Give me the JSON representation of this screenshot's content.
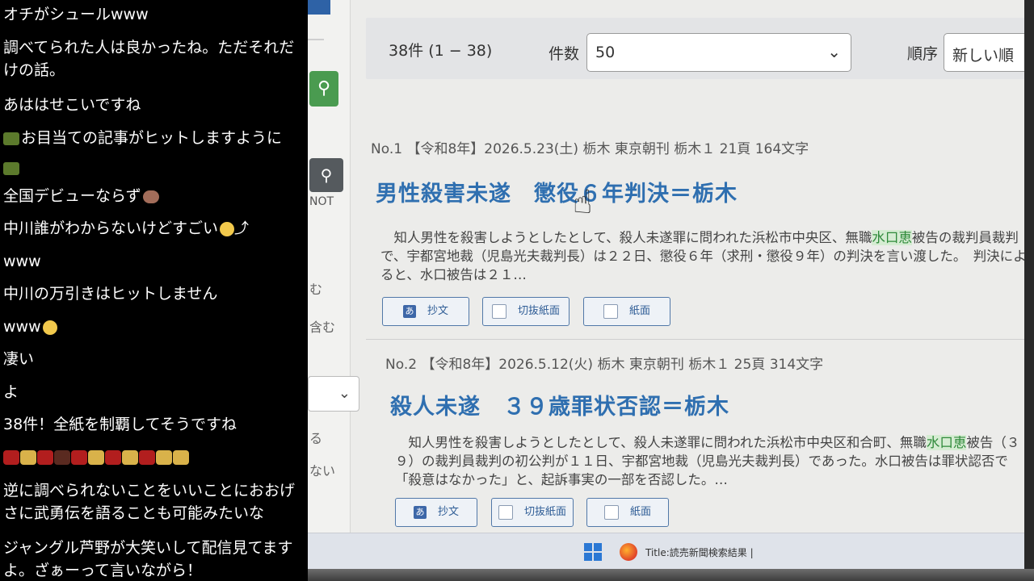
{
  "chat": {
    "messages": [
      "オチがシュールwww",
      "調べてられた人は良かったね。ただそれだけの話。",
      "あははせこいですね",
      "お目当ての記事がヒットしますように",
      "",
      "全国デビューならず",
      "中川誰がわからないけどすごい",
      "www",
      "中川の万引きはヒットしません",
      "www",
      "凄い",
      "よ",
      "38件！全紙を制覇してそうですね",
      "",
      "逆に調べられないことをいいことにおおげさに武勇伝を語ることも可能みたいな",
      "ジャングル芦野が大笑いして配信見てますよ。ざぁーって言いながら！"
    ]
  },
  "sidebar": {
    "not_label": "NOT",
    "frag1": "む",
    "frag2": "含む",
    "frag3": "る",
    "frag4": "ない"
  },
  "results": {
    "count_text": "38件 (1 − 38)",
    "per_page_label": "件数",
    "per_page_value": "50",
    "order_label": "順序",
    "order_value": "新しい順"
  },
  "articles": [
    {
      "meta": "No.1 【令和8年】2026.5.23(土) 栃木 東京朝刊 栃木１ 21頁 164文字",
      "headline": "男性殺害未遂　懲役６年判決＝栃木",
      "body_pre": "　知人男性を殺害しようとしたとして、殺人未遂罪に問われた浜松市中央区、無職",
      "body_hl": "水口恵",
      "body_post": "被告の裁判員裁判で、宇都宮地裁（児島光夫裁判長）は２２日、懲役６年（求刑・懲役９年）の判決を言い渡した。　判決によると、水口被告は２１…",
      "buttons": [
        "抄文",
        "切抜紙面",
        "紙面"
      ]
    },
    {
      "meta": "No.2 【令和8年】2026.5.12(火) 栃木 東京朝刊 栃木１ 25頁 314文字",
      "headline": "殺人未遂　３９歳罪状否認＝栃木",
      "body_pre": "　知人男性を殺害しようとしたとして、殺人未遂罪に問われた浜松市中央区和合町、無職",
      "body_hl": "水口恵",
      "body_post": "被告（３９）の裁判員裁判の初公判が１１日、宇都宮地裁（児島光夫裁判長）であった。水口被告は罪状認否で「殺意はなかった」と、起訴事実の一部を否認した。…",
      "buttons": [
        "抄文",
        "切抜紙面",
        "紙面"
      ]
    }
  ],
  "taskbar": {
    "title": "Title:読売新聞検索結果 |"
  }
}
